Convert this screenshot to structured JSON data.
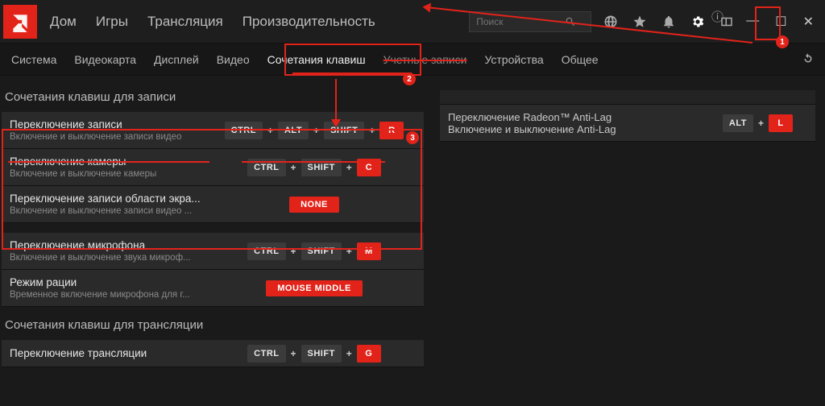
{
  "topnav": {
    "items": [
      "Дом",
      "Игры",
      "Трансляция",
      "Производительность"
    ]
  },
  "search": {
    "placeholder": "Поиск"
  },
  "subtabs": {
    "items": [
      "Система",
      "Видеокарта",
      "Дисплей",
      "Видео",
      "Сочетания клавиш",
      "Учетные записи",
      "Устройства",
      "Общее"
    ],
    "active_index": 4
  },
  "sections": {
    "recording": {
      "title": "Сочетания клавиш для записи",
      "rows": [
        {
          "title": "Переключение записи",
          "subtitle": "Включение и выключение записи видео",
          "keys": [
            "CTRL",
            "ALT",
            "SHIFT",
            "R"
          ],
          "last_red": true
        },
        {
          "title": "Переключение камеры",
          "subtitle": "Включение и выключение камеры",
          "keys": [
            "CTRL",
            "SHIFT",
            "C"
          ],
          "last_red": true
        },
        {
          "title": "Переключение записи области экра...",
          "subtitle": "Включение и выключение записи видео ...",
          "keys": [
            "NONE"
          ],
          "none": true
        },
        {
          "title": "Переключение микрофона",
          "subtitle": "Включение и выключение звука микроф...",
          "keys": [
            "CTRL",
            "SHIFT",
            "M"
          ],
          "last_red": true
        },
        {
          "title": "Режим рации",
          "subtitle": "Временное включение микрофона для г...",
          "keys": [
            "MOUSE MIDDLE"
          ],
          "none": true
        }
      ]
    },
    "streaming": {
      "title": "Сочетания клавиш для трансляции",
      "rows": [
        {
          "title": "Переключение трансляции",
          "subtitle": "",
          "keys": [
            "CTRL",
            "SHIFT",
            "G"
          ],
          "last_red": true
        }
      ]
    }
  },
  "rightcol": {
    "rows": [
      {
        "title": "Переключение Radeon™ Anti-Lag",
        "subtitle": "Включение и выключение Anti-Lag",
        "keys": [
          "ALT",
          "L"
        ],
        "last_red": true
      }
    ],
    "struck_subtab_index": 5
  },
  "badges": {
    "b1": "1",
    "b2": "2",
    "b3": "3"
  },
  "key_labels": {
    "CTRL": "CTRL",
    "ALT": "ALT",
    "SHIFT": "SHIFT",
    "R": "R",
    "C": "C",
    "M": "M",
    "G": "G",
    "L": "L",
    "NONE": "NONE",
    "MOUSE MIDDLE": "MOUSE MIDDLE"
  }
}
